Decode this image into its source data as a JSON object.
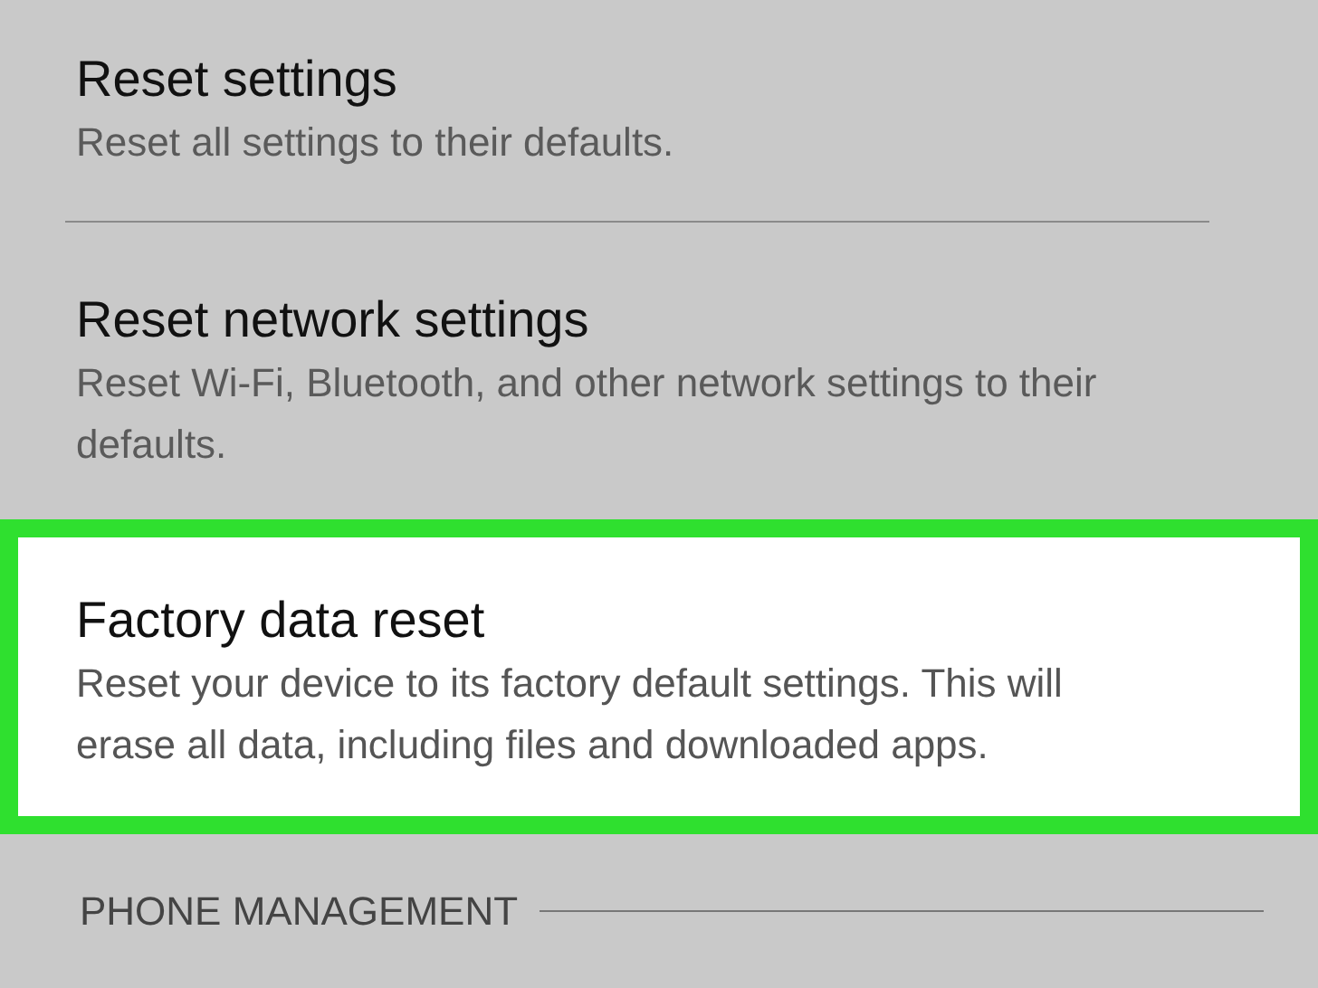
{
  "settings": [
    {
      "title": "Reset settings",
      "description": "Reset all settings to their defaults.",
      "highlighted": false,
      "divider_after": true
    },
    {
      "title": "Reset network settings",
      "description": "Reset Wi-Fi, Bluetooth, and other network settings to their defaults.",
      "highlighted": false,
      "divider_after": false
    },
    {
      "title": "Factory data reset",
      "description": "Reset your device to its factory default settings. This will erase all data, including files and downloaded apps.",
      "highlighted": true,
      "divider_after": false
    }
  ],
  "section_header": "PHONE MANAGEMENT"
}
